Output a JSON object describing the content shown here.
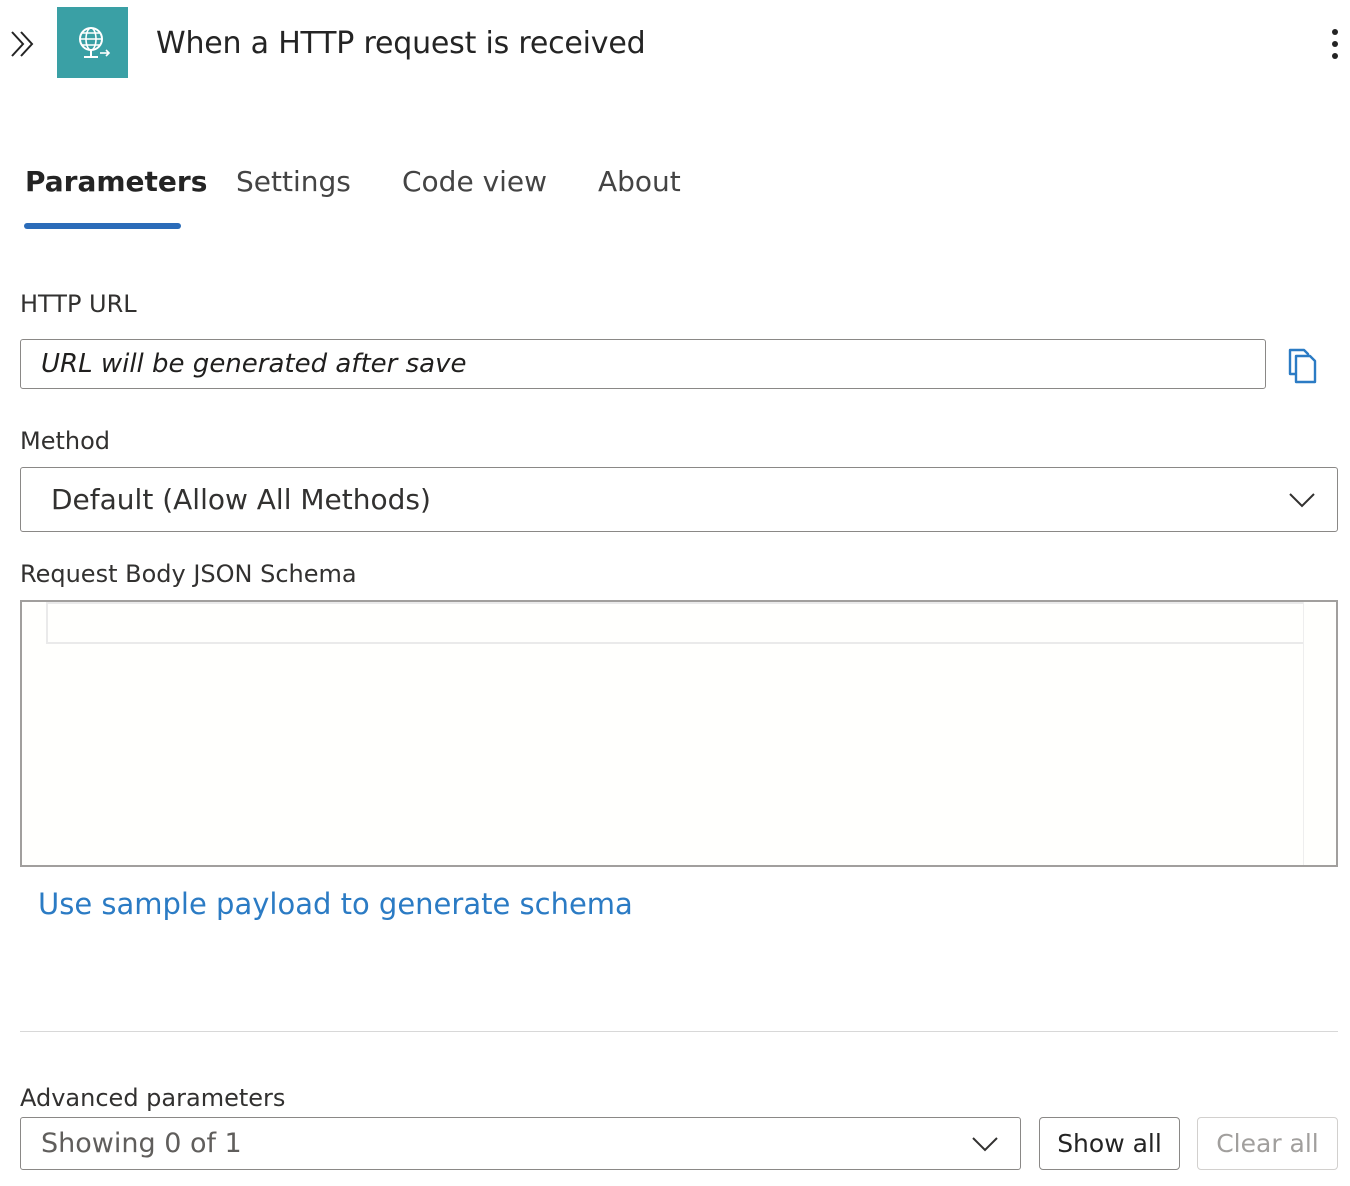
{
  "header": {
    "title": "When a HTTP request is received",
    "icon_name": "http-request-globe-icon",
    "icon_bg": "#3aa0a5"
  },
  "tabs": [
    {
      "label": "Parameters",
      "active": true
    },
    {
      "label": "Settings",
      "active": false
    },
    {
      "label": "Code view",
      "active": false
    },
    {
      "label": "About",
      "active": false
    }
  ],
  "accent_color": "#2b6cb9",
  "fields": {
    "http_url": {
      "label": "HTTP URL",
      "value": "URL will be generated after save"
    },
    "method": {
      "label": "Method",
      "selected": "Default (Allow All Methods)"
    },
    "schema": {
      "label": "Request Body JSON Schema",
      "value": ""
    }
  },
  "sample_link": "Use sample payload to generate schema",
  "advanced": {
    "label": "Advanced parameters",
    "selected": "Showing 0 of 1",
    "show_all": "Show all",
    "clear_all": "Clear all"
  }
}
